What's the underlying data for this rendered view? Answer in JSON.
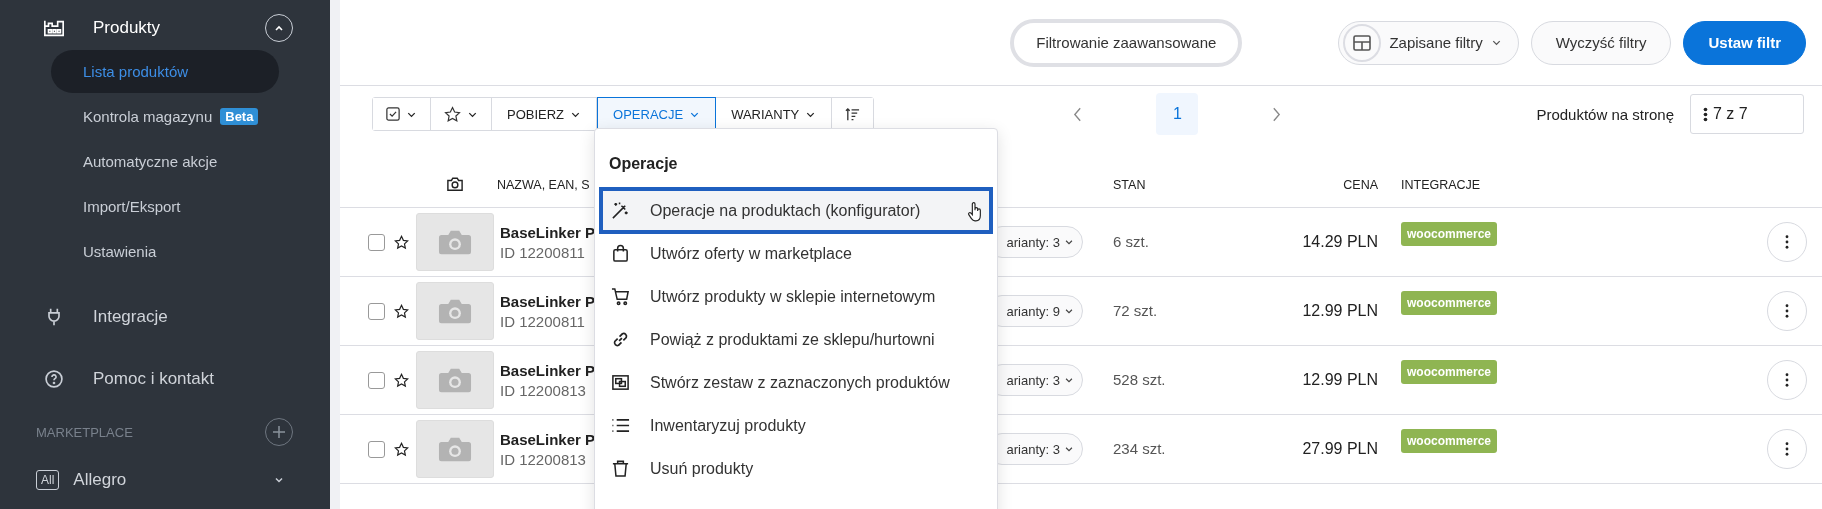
{
  "sidebar": {
    "sections": [
      {
        "label": "Produkty",
        "expanded": true,
        "items": [
          {
            "label": "Lista produktów",
            "selected": true
          },
          {
            "label": "Kontrola magazynu",
            "selected": false,
            "badge": "Beta"
          },
          {
            "label": "Automatyczne akcje",
            "selected": false
          },
          {
            "label": "Import/Eksport",
            "selected": false
          },
          {
            "label": "Ustawienia",
            "selected": false
          }
        ]
      },
      {
        "label": "Integracje"
      },
      {
        "label": "Pomoc i kontakt"
      }
    ],
    "marketplace": {
      "heading": "MARKETPLACE",
      "items": [
        {
          "tag": "All",
          "label": "Allegro",
          "expanded": false
        }
      ]
    }
  },
  "filter_bar": {
    "advanced": "Filtrowanie zaawansowane",
    "saved": "Zapisane filtry",
    "clear": "Wyczyść filtry",
    "apply": "Ustaw filtr"
  },
  "toolbar": {
    "actions": [
      {
        "kind": "checkbox",
        "selected": false
      },
      {
        "kind": "star",
        "selected": false
      },
      {
        "kind": "text",
        "label": "POBIERZ",
        "selected": false
      },
      {
        "kind": "text",
        "label": "OPERACJE",
        "selected": true
      },
      {
        "kind": "text",
        "label": "WARIANTY",
        "selected": false
      },
      {
        "kind": "sort",
        "selected": false
      }
    ],
    "pages": [
      {
        "label": "1",
        "selected": true
      }
    ],
    "per_page_label": "Produktów na stronę",
    "per_page_value": "7 z 7"
  },
  "table": {
    "columns": [
      "NAZWA, EAN, S",
      "STAN",
      "CENA",
      "INTEGRACJE"
    ],
    "rows": [
      {
        "checked": false,
        "starred": false,
        "name": "BaseLinker P",
        "id": "ID 12200811",
        "variants": "arianty: 3",
        "stock": "6 szt.",
        "price": "14.29 PLN",
        "integrations": [
          "woocommerce"
        ]
      },
      {
        "checked": false,
        "starred": false,
        "name": "BaseLinker P",
        "id": "ID 12200811",
        "variants": "arianty: 9",
        "stock": "72 szt.",
        "price": "12.99 PLN",
        "integrations": [
          "woocommerce"
        ]
      },
      {
        "checked": false,
        "starred": false,
        "name": "BaseLinker P",
        "id": "ID 12200813",
        "variants": "arianty: 3",
        "stock": "528 szt.",
        "price": "12.99 PLN",
        "integrations": [
          "woocommerce"
        ]
      },
      {
        "checked": false,
        "starred": false,
        "name": "BaseLinker P",
        "id": "ID 12200813",
        "variants": "arianty: 3",
        "stock": "234 szt.",
        "price": "27.99 PLN",
        "integrations": [
          "woocommerce"
        ]
      }
    ]
  },
  "dropdown": {
    "title": "Operacje",
    "items": [
      {
        "label": "Operacje na produktach (konfigurator)",
        "selected": true
      },
      {
        "label": "Utwórz oferty w marketplace",
        "selected": false
      },
      {
        "label": "Utwórz produkty w sklepie internetowym",
        "selected": false
      },
      {
        "label": "Powiąż z produktami ze sklepu/hurtowni",
        "selected": false
      },
      {
        "label": "Stwórz zestaw z zaznaczonych produktów",
        "selected": false
      },
      {
        "label": "Inwentaryzuj produkty",
        "selected": false
      },
      {
        "label": "Usuń produkty",
        "selected": false
      }
    ]
  }
}
